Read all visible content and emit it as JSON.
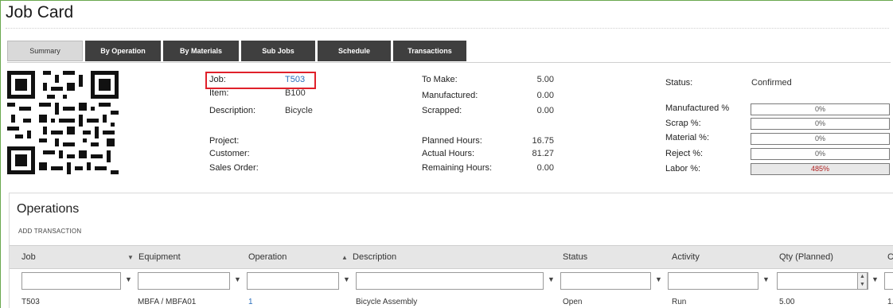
{
  "title": "Job Card",
  "tabs": [
    "Summary",
    "By Operation",
    "By Materials",
    "Sub Jobs",
    "Schedule",
    "Transactions"
  ],
  "job": {
    "job_label": "Job:",
    "job_value": "T503",
    "item_label": "Item:",
    "item_value": "B100",
    "description_label": "Description:",
    "description_value": "Bicycle",
    "project_label": "Project:",
    "customer_label": "Customer:",
    "sales_order_label": "Sales Order:"
  },
  "quantities": {
    "to_make_label": "To Make:",
    "to_make_value": "5.00",
    "manufactured_label": "Manufactured:",
    "manufactured_value": "0.00",
    "scrapped_label": "Scrapped:",
    "scrapped_value": "0.00",
    "planned_hours_label": "Planned Hours:",
    "planned_hours_value": "16.75",
    "actual_hours_label": "Actual Hours:",
    "actual_hours_value": "81.27",
    "remaining_hours_label": "Remaining Hours:",
    "remaining_hours_value": "0.00"
  },
  "status": {
    "status_label": "Status:",
    "status_value": "Confirmed",
    "manufactured_pct_label": "Manufactured %",
    "manufactured_pct_value": "0%",
    "scrap_pct_label": "Scrap %:",
    "scrap_pct_value": "0%",
    "material_pct_label": "Material %:",
    "material_pct_value": "0%",
    "reject_pct_label": "Reject %:",
    "reject_pct_value": "0%",
    "labor_pct_label": "Labor %:",
    "labor_pct_value": "485%"
  },
  "operations": {
    "title": "Operations",
    "add_transaction": "ADD TRANSACTION",
    "columns": [
      "Job",
      "Equipment",
      "Operation",
      "Description",
      "Status",
      "Activity",
      "Qty (Planned)",
      "C"
    ],
    "rows": [
      [
        "T503",
        "MBFA / MBFA01",
        "1",
        "Bicycle Assembly",
        "Open",
        "Run",
        "5.00",
        "1."
      ]
    ]
  },
  "colors": {
    "accent_link": "#2a6ebb",
    "tab_dark": "#3f3f3f",
    "highlight_red": "#e0202a",
    "labor_red": "#b02020"
  }
}
